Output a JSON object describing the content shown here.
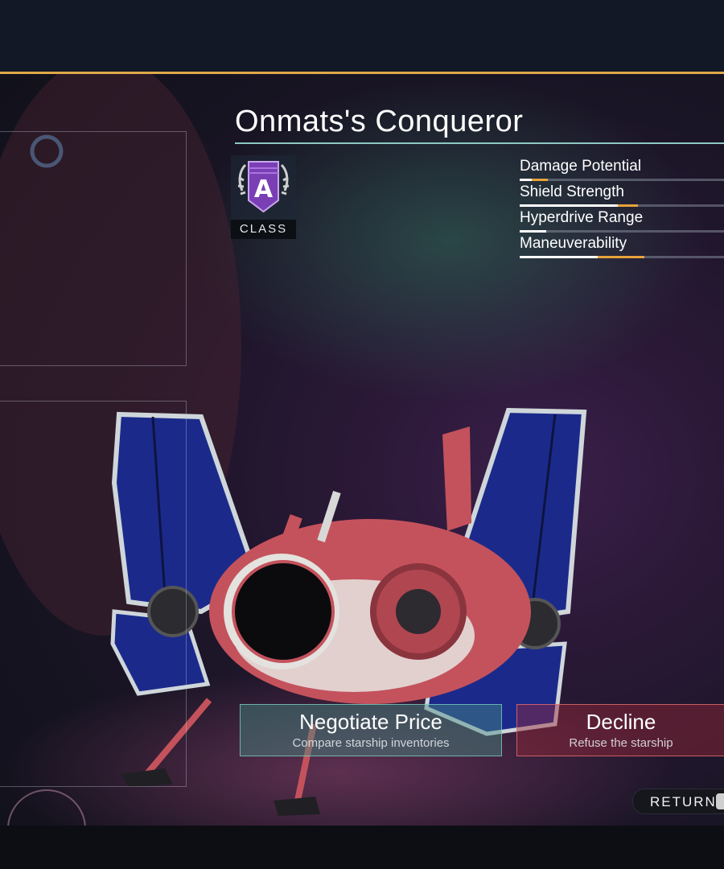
{
  "ship": {
    "name": "Onmats's Conqueror",
    "class_label": "CLASS",
    "class_grade": "A"
  },
  "stats": [
    {
      "label": "Damage Potential",
      "base": 0.06,
      "bonus": 0.08
    },
    {
      "label": "Shield Strength",
      "base": 0.48,
      "bonus": 0.1
    },
    {
      "label": "Hyperdrive Range",
      "base": 0.13,
      "bonus": 0.0
    },
    {
      "label": "Maneuverability",
      "base": 0.38,
      "bonus": 0.23
    }
  ],
  "actions": {
    "negotiate": {
      "label": "Negotiate Price",
      "sub": "Compare starship inventories"
    },
    "decline": {
      "label": "Decline",
      "sub": "Refuse the starship"
    },
    "return": {
      "label": "RETURN"
    }
  },
  "colors": {
    "accent_gold": "#e0a84a",
    "title_rule": "#8ec8c4",
    "stat_bonus": "#e8a23a",
    "badge_purple": "#7b3fb5",
    "negotiate_fill": "#468c82",
    "decline_fill": "#962837"
  }
}
